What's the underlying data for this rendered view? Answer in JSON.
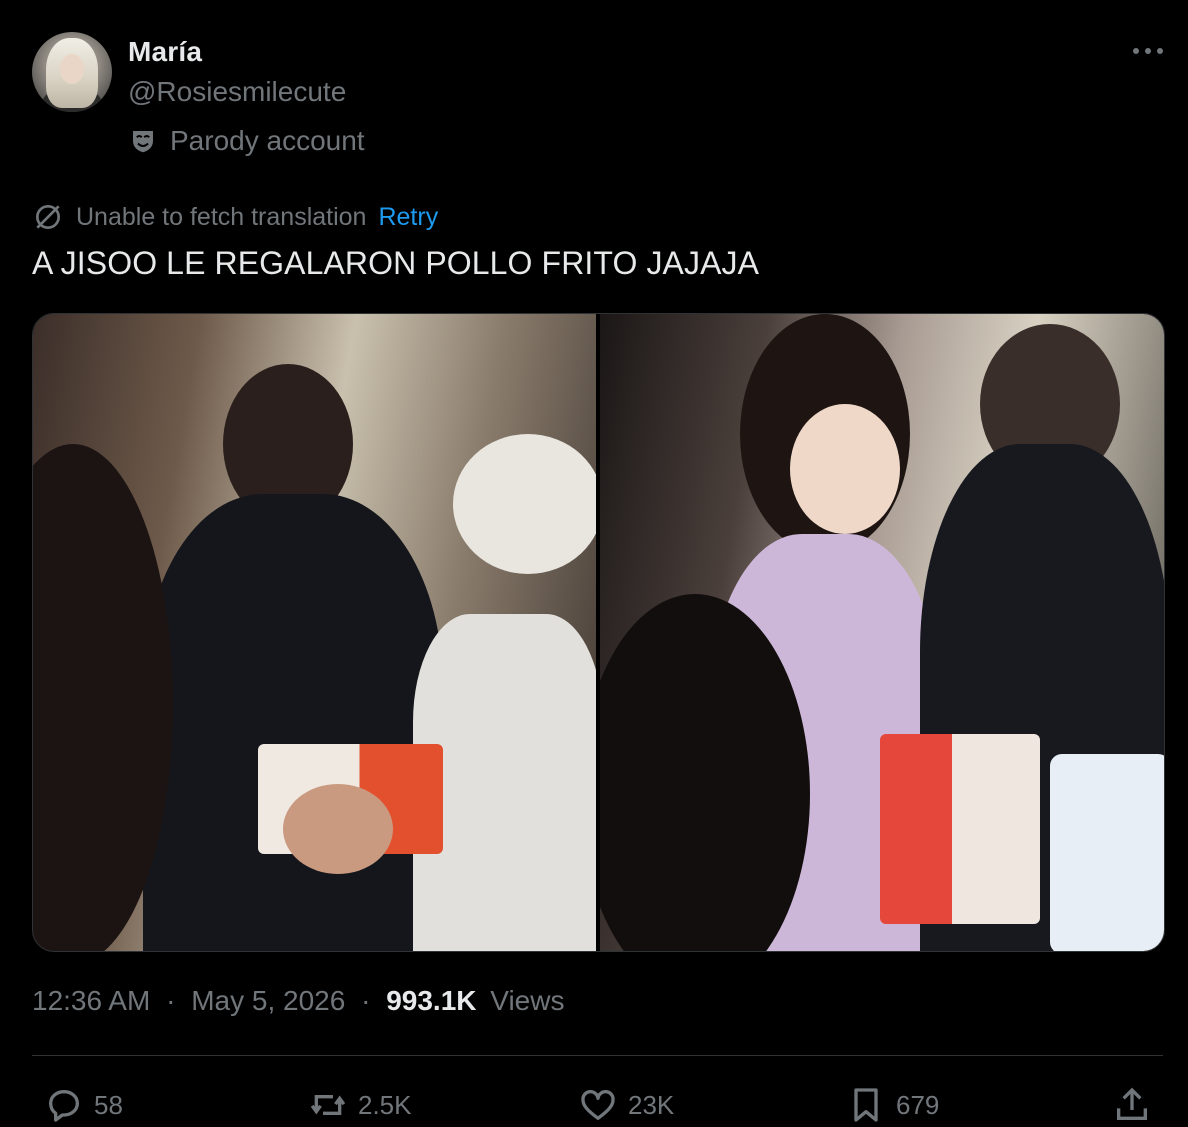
{
  "author": {
    "display_name": "María",
    "handle": "@Rosiesmilecute",
    "label": "Parody account",
    "avatar_icon": "avatar-photo",
    "label_icon": "theater-mask-icon"
  },
  "translation": {
    "status": "Unable to fetch translation",
    "retry_label": "Retry",
    "icon": "translate-off-icon"
  },
  "tweet": {
    "text": "A JISOO LE REGALARON POLLO FRITO JAJAJA",
    "media": [
      {
        "alt_icon": "photo-left"
      },
      {
        "alt_icon": "photo-right"
      }
    ]
  },
  "meta": {
    "time": "12:36 AM",
    "separator": "·",
    "date": "May 5, 2026",
    "views_count": "993.1K",
    "views_label": "Views"
  },
  "actions": {
    "replies": "58",
    "reposts": "2.5K",
    "likes": "23K",
    "bookmarks": "679"
  },
  "colors": {
    "background": "#000000",
    "primary_text": "#e7e9ea",
    "secondary_text": "#71767b",
    "link": "#1d9bf0",
    "border": "#2f3336"
  }
}
